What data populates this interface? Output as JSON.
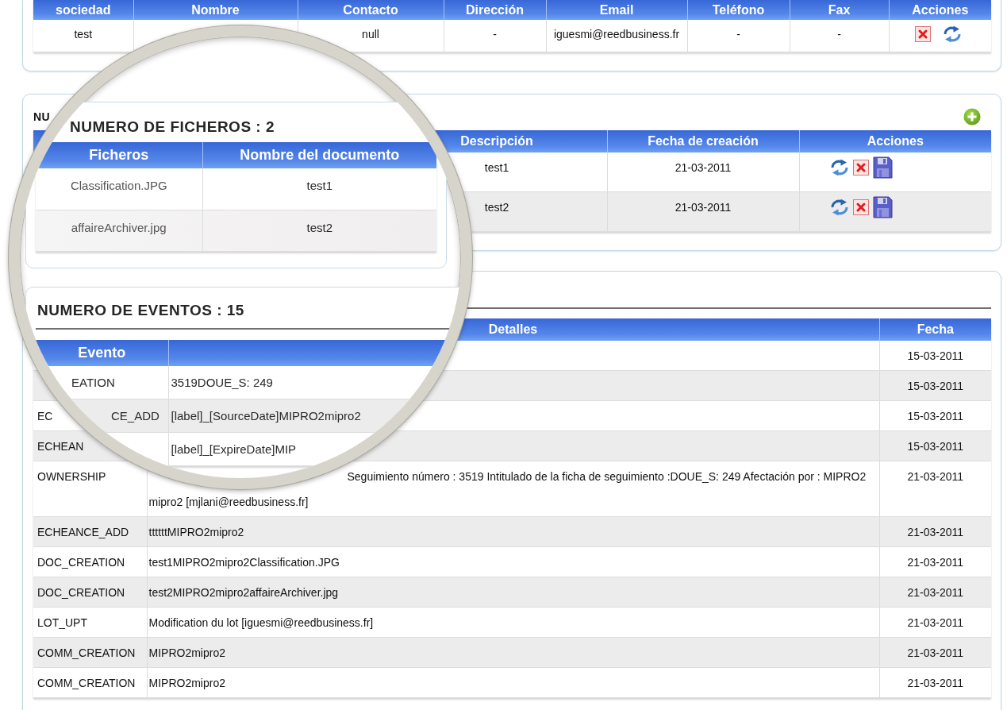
{
  "companies": {
    "columns": [
      "sociedad",
      "Nombre",
      "Contacto",
      "Dirección",
      "Email",
      "Teléfono",
      "Fax",
      "Acciones"
    ],
    "rows": [
      {
        "cells": [
          "test",
          null,
          "null",
          "-",
          "iguesmi@reedbusiness.fr",
          "-",
          "-"
        ],
        "actions": [
          {
            "kind": "delete"
          },
          {
            "kind": "refresh"
          }
        ]
      }
    ]
  },
  "files": {
    "title": "NU",
    "columns": [
      null,
      null,
      "Descripción",
      "Fecha de creación",
      "Acciones"
    ],
    "rows": [
      {
        "cells": [
          null,
          null,
          "test1",
          "21-03-2011"
        ],
        "actions": [
          {
            "kind": "refresh"
          },
          {
            "kind": "delete"
          },
          {
            "kind": "save"
          }
        ]
      },
      {
        "cells": [
          null,
          null,
          "test2",
          "21-03-2011"
        ],
        "actions": [
          {
            "kind": "refresh"
          },
          {
            "kind": "delete"
          },
          {
            "kind": "save"
          }
        ]
      }
    ]
  },
  "events": {
    "columns": [
      null,
      "Detalles",
      "Fecha"
    ],
    "rows": [
      {
        "date": "15-03-2011"
      },
      {
        "date": "15-03-2011"
      },
      {
        "event": "EC",
        "date": "15-03-2011"
      },
      {
        "event": "ECHEAN",
        "date": "15-03-2011"
      },
      {
        "event": "OWNERSHIP",
        "details": "Seguimiento número : 3519 Intitulado de la ficha de seguimiento :DOUE_S: 249 Afectación por : MIPRO2 mipro2 [mjlani@reedbusiness.fr]",
        "date": "21-03-2011"
      },
      {
        "event": "ECHEANCE_ADD",
        "details": "ttttttMIPRO2mipro2",
        "date": "21-03-2011"
      },
      {
        "event": "DOC_CREATION",
        "details": "test1MIPRO2mipro2Classification.JPG",
        "date": "21-03-2011"
      },
      {
        "event": "DOC_CREATION",
        "details": "test2MIPRO2mipro2affaireArchiver.jpg",
        "date": "21-03-2011"
      },
      {
        "event": "LOT_UPT",
        "details": "Modification du lot [iguesmi@reedbusiness.fr]",
        "date": "21-03-2011"
      },
      {
        "event": "COMM_CREATION",
        "details": "MIPRO2mipro2",
        "date": "21-03-2011"
      },
      {
        "event": "COMM_CREATION",
        "details": "MIPRO2mipro2",
        "date": "21-03-2011"
      }
    ]
  },
  "magnifier": {
    "files": {
      "title": "NUMERO DE FICHEROS : 2",
      "columns": [
        "Ficheros",
        "Nombre del documento"
      ],
      "rows": [
        [
          "Classification.JPG",
          "test1"
        ],
        [
          "affaireArchiver.jpg",
          "test2"
        ]
      ]
    },
    "events": {
      "title": "NUMERO DE EVENTOS : 15",
      "columns": [
        "Evento",
        null
      ],
      "rows": [
        {
          "event": "EATION",
          "details": "3519DOUE_S: 249"
        },
        {
          "event": "CE_ADD",
          "details": "[label]_[SourceDate]MIPRO2mipro2"
        },
        {
          "details": "[label]_[ExpireDate]MIP"
        }
      ]
    }
  }
}
